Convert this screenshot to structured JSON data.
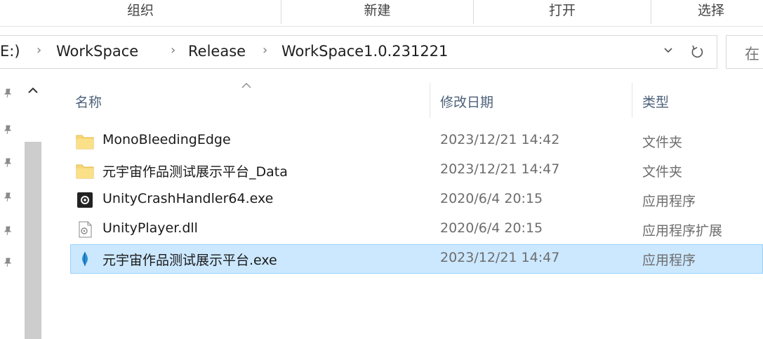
{
  "ribbon": {
    "groups": [
      "组织",
      "新建",
      "打开",
      "选择"
    ]
  },
  "address": {
    "crumbs": [
      "E:)",
      "WorkSpace",
      "Release",
      "WorkSpace1.0.231221"
    ],
    "separator": "›",
    "dropdown_icon": "chevron-down-icon",
    "refresh_icon": "refresh-icon",
    "search_text": "在"
  },
  "nav": {
    "pin_icon": "pin-icon",
    "pins": 5,
    "up_icon": "chevron-up-icon"
  },
  "columns": {
    "name": "名称",
    "date": "修改日期",
    "type": "类型",
    "sort_icon": "sort-ascending-icon"
  },
  "files": [
    {
      "name": "MonoBleedingEdge",
      "date": "2023/12/21 14:42",
      "type": "文件夹",
      "icon": "folder-icon",
      "selected": false
    },
    {
      "name": "元宇宙作品测试展示平台_Data",
      "date": "2023/12/21 14:47",
      "type": "文件夹",
      "icon": "folder-icon",
      "selected": false
    },
    {
      "name": "UnityCrashHandler64.exe",
      "date": "2020/6/4 20:15",
      "type": "应用程序",
      "icon": "unity-icon",
      "selected": false
    },
    {
      "name": "UnityPlayer.dll",
      "date": "2020/6/4 20:15",
      "type": "应用程序扩展",
      "icon": "dll-file-icon",
      "selected": false
    },
    {
      "name": "元宇宙作品测试展示平台.exe",
      "date": "2023/12/21 14:47",
      "type": "应用程序",
      "icon": "app-exe-icon",
      "selected": true
    }
  ],
  "colors": {
    "selection_bg": "#cce8ff",
    "selection_border": "#99d1ff",
    "folder": "#f8d775",
    "header_text": "#4c607a"
  }
}
